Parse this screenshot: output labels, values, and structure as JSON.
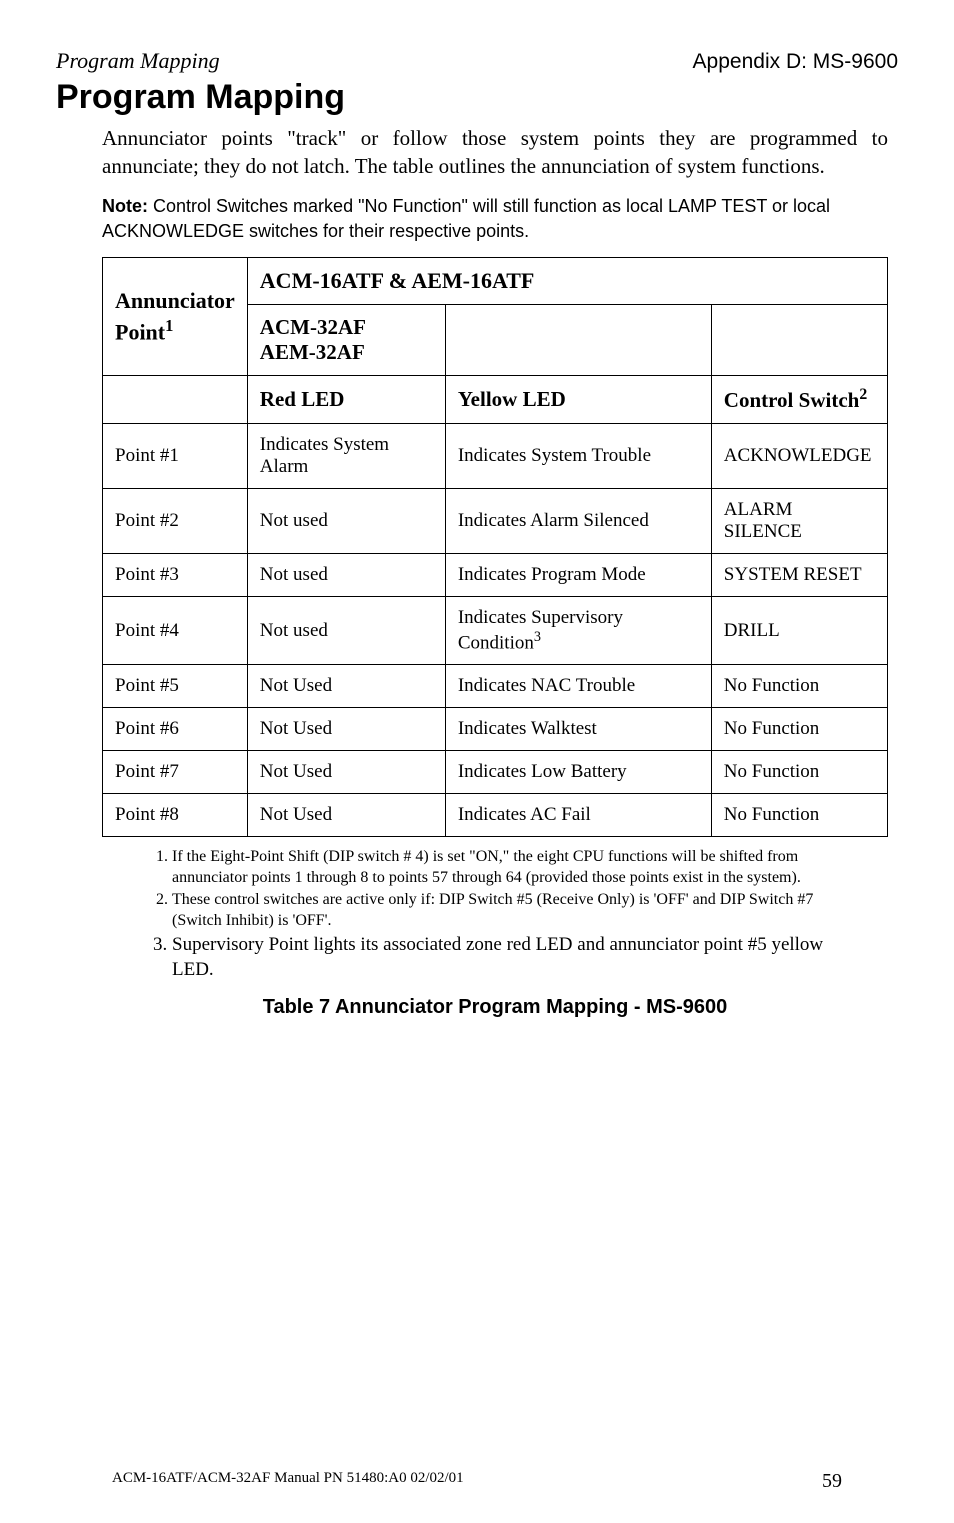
{
  "header": {
    "left": "Program Mapping",
    "right": "Appendix D: MS-9600"
  },
  "title": "Program Mapping",
  "intro": "Annunciator points \"track\" or follow those system points they are programmed to annunciate; they do not latch. The table outlines the annunciation of system functions.",
  "note_label": "Note:",
  "note_text": " Control Switches marked \"No Function\" will still function as local LAMP TEST or local ACKNOWLEDGE switches for their respective points.",
  "table": {
    "top_header": "ACM-16ATF & AEM-16ATF",
    "ann_header_line1": "Annunciator",
    "ann_header_line2": "Point",
    "ann_header_sup": "1",
    "mid_line1": "ACM-32AF",
    "mid_line2": "AEM-32AF",
    "sub_redled": "Red LED",
    "sub_yellowled": "Yellow LED",
    "sub_ctrl": "Control Switch",
    "sub_ctrl_sup": "2",
    "rows": [
      {
        "p": "Point #1",
        "r": "Indicates System Alarm",
        "y": "Indicates System Trouble",
        "c": "ACKNOWLEDGE"
      },
      {
        "p": "Point #2",
        "r": "Not used",
        "y": "Indicates Alarm Silenced",
        "c": "ALARM SILENCE"
      },
      {
        "p": "Point #3",
        "r": "Not used",
        "y": "Indicates Program Mode",
        "c": "SYSTEM RESET"
      },
      {
        "p": "Point #4",
        "r": "Not used",
        "y_pre": "Indicates Supervisory Condition",
        "y_sup": "3",
        "c": "DRILL"
      },
      {
        "p": "Point #5",
        "r": "Not Used",
        "y": "Indicates NAC Trouble",
        "c": "No Function"
      },
      {
        "p": "Point #6",
        "r": "Not Used",
        "y": "Indicates Walktest",
        "c": "No Function"
      },
      {
        "p": "Point #7",
        "r": "Not Used",
        "y": "Indicates Low Battery",
        "c": "No Function"
      },
      {
        "p": "Point #8",
        "r": "Not Used",
        "y": "Indicates AC Fail",
        "c": "No Function"
      }
    ]
  },
  "footnotes": {
    "f1": "If the Eight-Point Shift (DIP switch # 4) is set \"ON,\" the eight CPU functions will be shifted from annunciator points 1 through 8 to points 57 through 64 (provided those points exist in the system).",
    "f2": "These control switches are active only if: DIP Switch #5 (Receive Only) is 'OFF' and DIP Switch #7 (Switch Inhibit) is 'OFF'.",
    "f3": "Supervisory Point lights its associated zone red LED and annunciator point #5 yellow LED."
  },
  "caption": "Table 7  Annunciator Program Mapping - MS-9600",
  "footer": {
    "left": "ACM-16ATF/ACM-32AF Manual  PN 51480:A0  02/02/01",
    "page": "59"
  }
}
